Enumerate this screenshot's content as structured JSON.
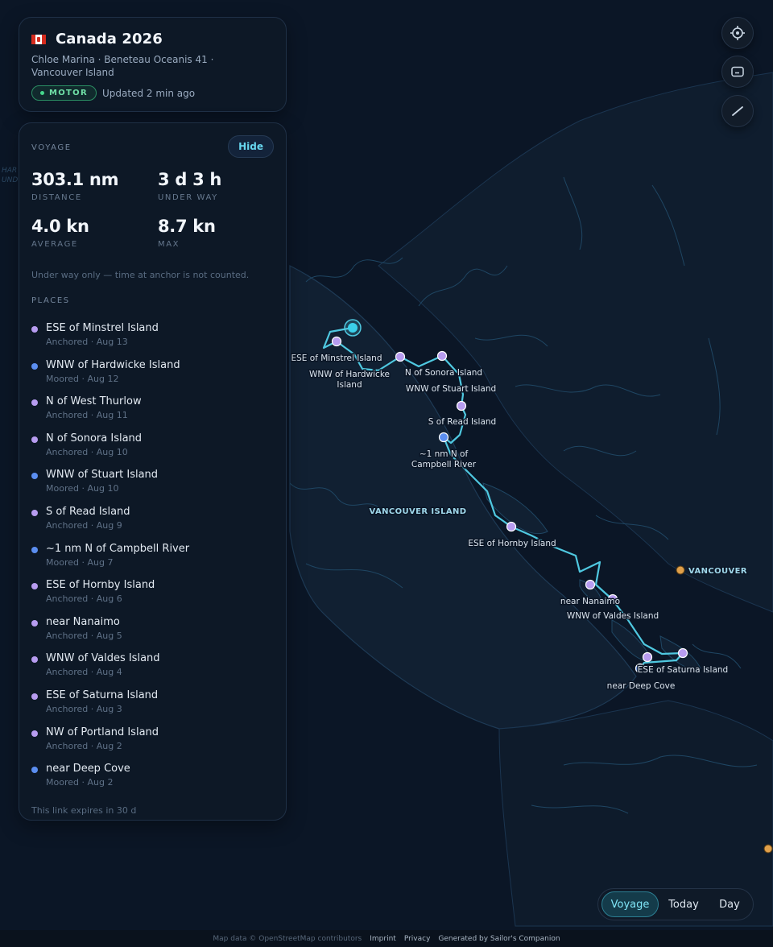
{
  "header": {
    "title": "Canada 2026",
    "subtitle": "Chloe Marina · Beneteau Oceanis 41 · Vancouver Island",
    "badge": "MOTOR",
    "updated": "Updated 2 min ago"
  },
  "voyage": {
    "section_label": "VOYAGE",
    "hide_label": "Hide",
    "stats": {
      "distance": {
        "value": "303.1 nm",
        "label": "DISTANCE"
      },
      "underway": {
        "value": "3 d 3 h",
        "label": "UNDER WAY"
      },
      "average": {
        "value": "4.0 kn",
        "label": "AVERAGE"
      },
      "max": {
        "value": "8.7 kn",
        "label": "MAX"
      }
    },
    "note": "Under way only — time at anchor is not counted.",
    "places_label": "PLACES",
    "places": [
      {
        "name": "ESE of Minstrel Island",
        "meta": "Anchored · Aug 13",
        "color": "#b79cf0"
      },
      {
        "name": "WNW of Hardwicke Island",
        "meta": "Moored · Aug 12",
        "color": "#5b8ef0"
      },
      {
        "name": "N of West Thurlow",
        "meta": "Anchored · Aug 11",
        "color": "#b79cf0"
      },
      {
        "name": "N of Sonora Island",
        "meta": "Anchored · Aug 10",
        "color": "#b79cf0"
      },
      {
        "name": "WNW of Stuart Island",
        "meta": "Moored · Aug 10",
        "color": "#5b8ef0"
      },
      {
        "name": "S of Read Island",
        "meta": "Anchored · Aug 9",
        "color": "#b79cf0"
      },
      {
        "name": "~1 nm N of Campbell River",
        "meta": "Moored · Aug 7",
        "color": "#5b8ef0"
      },
      {
        "name": "ESE of Hornby Island",
        "meta": "Anchored · Aug 6",
        "color": "#b79cf0"
      },
      {
        "name": "near Nanaimo",
        "meta": "Anchored · Aug 5",
        "color": "#b79cf0"
      },
      {
        "name": "WNW of Valdes Island",
        "meta": "Anchored · Aug 4",
        "color": "#b79cf0"
      },
      {
        "name": "ESE of Saturna Island",
        "meta": "Anchored · Aug 3",
        "color": "#b79cf0"
      },
      {
        "name": "NW of Portland Island",
        "meta": "Anchored · Aug 2",
        "color": "#b79cf0"
      },
      {
        "name": "near Deep Cove",
        "meta": "Moored · Aug 2",
        "color": "#5b8ef0"
      }
    ],
    "expires": "This link expires in 30 d"
  },
  "map": {
    "labels": {
      "vancouver_island": "VANCOUVER ISLAND",
      "vancouver": "VANCOUVER",
      "edge_1": "HAR",
      "edge_2": "UND",
      "minstrel": "ESE of Minstrel Island",
      "hardwicke_1": "WNW of Hardwicke",
      "hardwicke_2": "Island",
      "sonora": "N of Sonora Island",
      "stuart": "WNW of Stuart Island",
      "read": "S of Read Island",
      "campbell_1": "~1 nm N of",
      "campbell_2": "Campbell River",
      "hornby": "ESE of Hornby Island",
      "nanaimo": "near Nanaimo",
      "valdes": "WNW of Valdes Island",
      "saturna": "ESE of Saturna Island",
      "deep_cove": "near Deep Cove"
    },
    "colors": {
      "track": "#4fc8e0",
      "anchored": "#b79cf0",
      "moored": "#5b8ef0",
      "city": "#e0a04a"
    }
  },
  "controls": {
    "locate_icon": "crosshair-icon",
    "layers_icon": "layers-icon",
    "measure_icon": "ruler-line-icon"
  },
  "mode_toggle": {
    "voyage": "Voyage",
    "today": "Today",
    "day": "Day",
    "active": "voyage"
  },
  "footer": {
    "attribution": "Map data © OpenStreetMap contributors",
    "imprint": "Imprint",
    "privacy": "Privacy",
    "generated": "Generated by Sailor's Companion"
  }
}
